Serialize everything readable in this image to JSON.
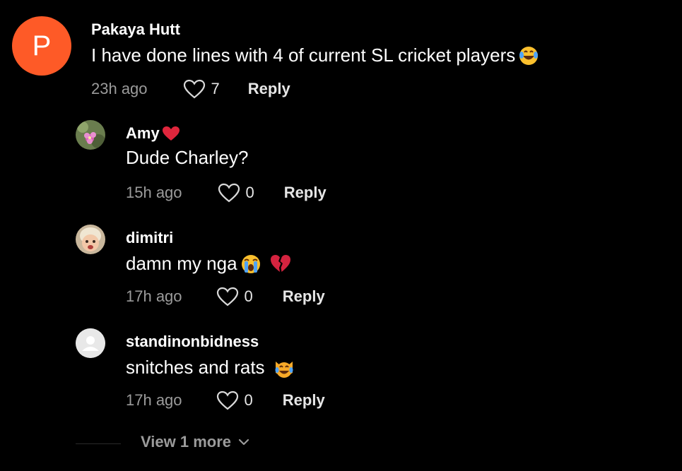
{
  "comments": [
    {
      "avatar_letter": "P",
      "username": "Pakaya Hutt",
      "text": "I have done lines with 4 of current SL cricket players",
      "time": "23h ago",
      "likes": "7",
      "reply_label": "Reply",
      "emoji": "tears-of-joy-emoji"
    }
  ],
  "replies": [
    {
      "username": "Amy",
      "text": "Dude Charley?",
      "time": "15h ago",
      "likes": "0",
      "reply_label": "Reply",
      "name_emoji": "red-heart-emoji"
    },
    {
      "username": "dimitri",
      "text": "damn my nga",
      "time": "17h ago",
      "likes": "0",
      "reply_label": "Reply",
      "emojis": [
        "crying-face-emoji",
        "broken-heart-emoji"
      ]
    },
    {
      "username": "standinonbidness",
      "text": "snitches and rats",
      "time": "17h ago",
      "likes": "0",
      "reply_label": "Reply",
      "emoji": "joy-cat-emoji"
    }
  ],
  "view_more": {
    "label": "View 1 more"
  },
  "colors": {
    "background": "#000000",
    "avatar_orange": "#fe5a27",
    "muted_text": "#9b9b9b",
    "text": "#ffffff"
  }
}
